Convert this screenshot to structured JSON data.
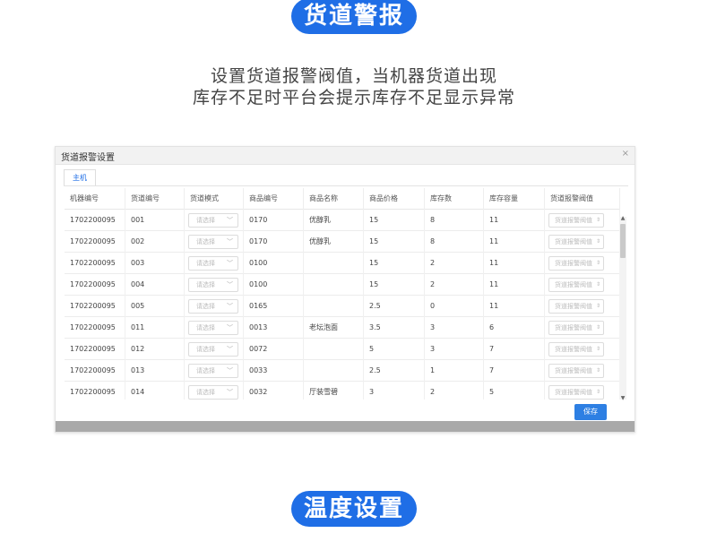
{
  "banner_top": {
    "label": "货道警报"
  },
  "description": {
    "line1": "设置货道报警阀值，当机器货道出现",
    "line2": "库存不足时平台会提示库存不足显示异常"
  },
  "dialog": {
    "title": "货道报警设置",
    "close_icon": "×",
    "tab_label": "主机",
    "columns": [
      "机器编号",
      "货道编号",
      "货道模式",
      "商品编号",
      "商品名称",
      "商品价格",
      "库存数",
      "库存容量",
      "货道报警阀值"
    ],
    "select_placeholder": "请选择",
    "threshold_placeholder": "货道报警阀值",
    "rows": [
      [
        "1702200095",
        "001",
        "0170",
        "优醇乳",
        "15",
        "8",
        "11"
      ],
      [
        "1702200095",
        "002",
        "0170",
        "优醇乳",
        "15",
        "8",
        "11"
      ],
      [
        "1702200095",
        "003",
        "0100",
        "",
        "15",
        "2",
        "11"
      ],
      [
        "1702200095",
        "004",
        "0100",
        "",
        "15",
        "2",
        "11"
      ],
      [
        "1702200095",
        "005",
        "0165",
        "",
        "2.5",
        "0",
        "11"
      ],
      [
        "1702200095",
        "011",
        "0013",
        "老坛泡面",
        "3.5",
        "3",
        "6"
      ],
      [
        "1702200095",
        "012",
        "0072",
        "",
        "5",
        "3",
        "7"
      ],
      [
        "1702200095",
        "013",
        "0033",
        "",
        "2.5",
        "1",
        "7"
      ],
      [
        "1702200095",
        "014",
        "0032",
        "厅装雪碧",
        "3",
        "2",
        "5"
      ]
    ],
    "save_label": "保存"
  },
  "banner_bottom": {
    "label": "温度设置"
  },
  "colors": {
    "accent": "#1f6ee6",
    "button": "#2d7fe3",
    "footer": "#a9a9a9"
  },
  "icons": {
    "close": "close-icon",
    "dropdown": "chevron-down-icon",
    "spinner": "spinner-icon"
  }
}
